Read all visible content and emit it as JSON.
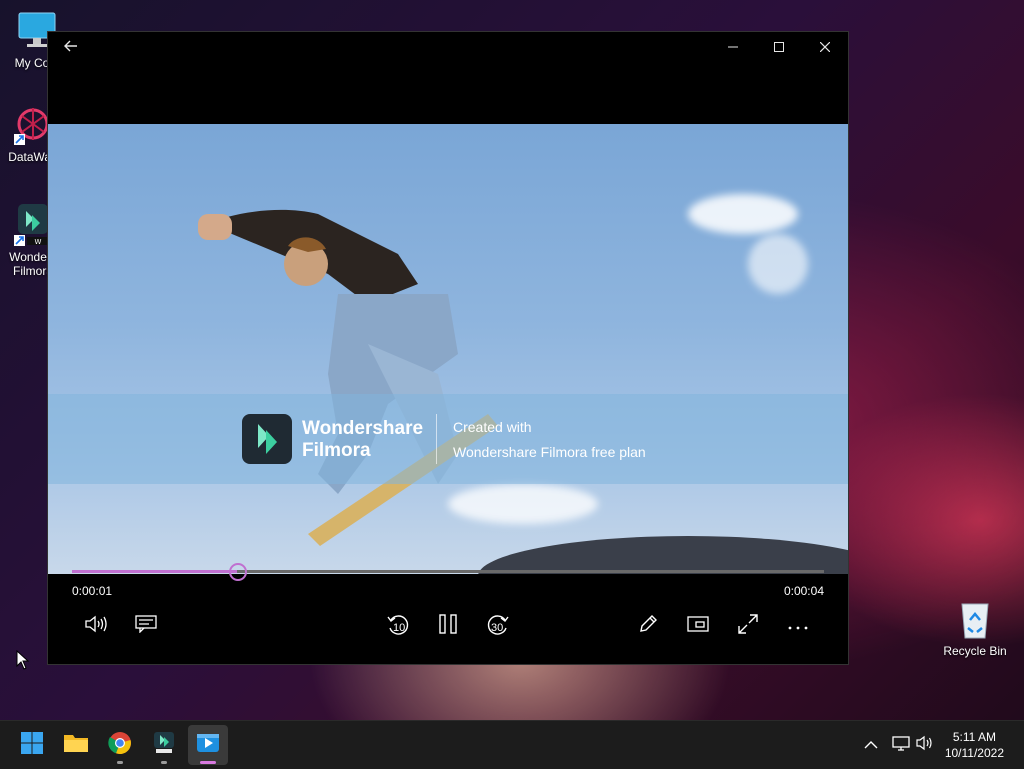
{
  "desktop": {
    "icons": [
      {
        "label": "My Com",
        "icon": "computer-icon"
      },
      {
        "label": "DataWag",
        "icon": "datawag-icon"
      },
      {
        "label": "Wonders",
        "label2": "Filmora",
        "icon": "filmora-icon"
      },
      {
        "label": "Recycle Bin",
        "icon": "recycle-bin-icon"
      }
    ]
  },
  "player": {
    "back_icon": "back-arrow-icon",
    "window_controls": [
      "minimize-icon",
      "maximize-icon",
      "close-icon"
    ],
    "watermark": {
      "brand_line1": "Wondershare",
      "brand_line2": "Filmora",
      "created_with": "Created with",
      "plan_text": "Wondershare Filmora free plan"
    },
    "elapsed": "0:00:01",
    "total": "0:00:04",
    "progress_fraction": 0.22,
    "controls": {
      "volume": "volume-icon",
      "captions": "captions-icon",
      "skip_back_label": "10",
      "play_pause": "pause-icon",
      "skip_forward_label": "30",
      "edit": "pencil-icon",
      "mini_view": "mini-view-icon",
      "fullscreen": "fullscreen-icon",
      "more": "more-icon"
    },
    "accent_color": "#c070d0"
  },
  "taskbar": {
    "apps": [
      "start-icon",
      "file-explorer-icon",
      "chrome-icon",
      "filmora-taskbar-icon",
      "media-player-icon"
    ],
    "tray": [
      "chevron-up-icon",
      "network-icon",
      "speaker-icon"
    ],
    "time": "5:11 AM",
    "date": "10/11/2022"
  }
}
